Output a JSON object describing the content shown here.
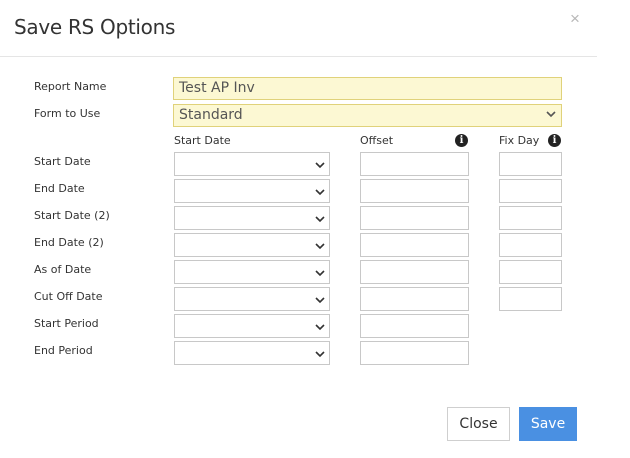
{
  "dialog": {
    "title": "Save RS Options",
    "close_glyph": "×"
  },
  "fields": {
    "report_name_label": "Report Name",
    "report_name_value": "Test AP Inv",
    "form_label": "Form to Use",
    "form_value": "Standard"
  },
  "columns": {
    "start_date": "Start Date",
    "offset": "Offset",
    "fix_day": "Fix Day",
    "info_glyph": "i"
  },
  "rows": [
    {
      "label": "Start Date",
      "has_fix": true
    },
    {
      "label": "End Date",
      "has_fix": true
    },
    {
      "label": "Start Date (2)",
      "has_fix": true
    },
    {
      "label": "End Date (2)",
      "has_fix": true
    },
    {
      "label": "As of Date",
      "has_fix": true
    },
    {
      "label": "Cut Off Date",
      "has_fix": true
    },
    {
      "label": "Start Period",
      "has_fix": false
    },
    {
      "label": "End Period",
      "has_fix": false
    }
  ],
  "buttons": {
    "close": "Close",
    "save": "Save"
  },
  "colors": {
    "accent": "#4a90e2",
    "highlight_bg": "#fcf8d3"
  }
}
